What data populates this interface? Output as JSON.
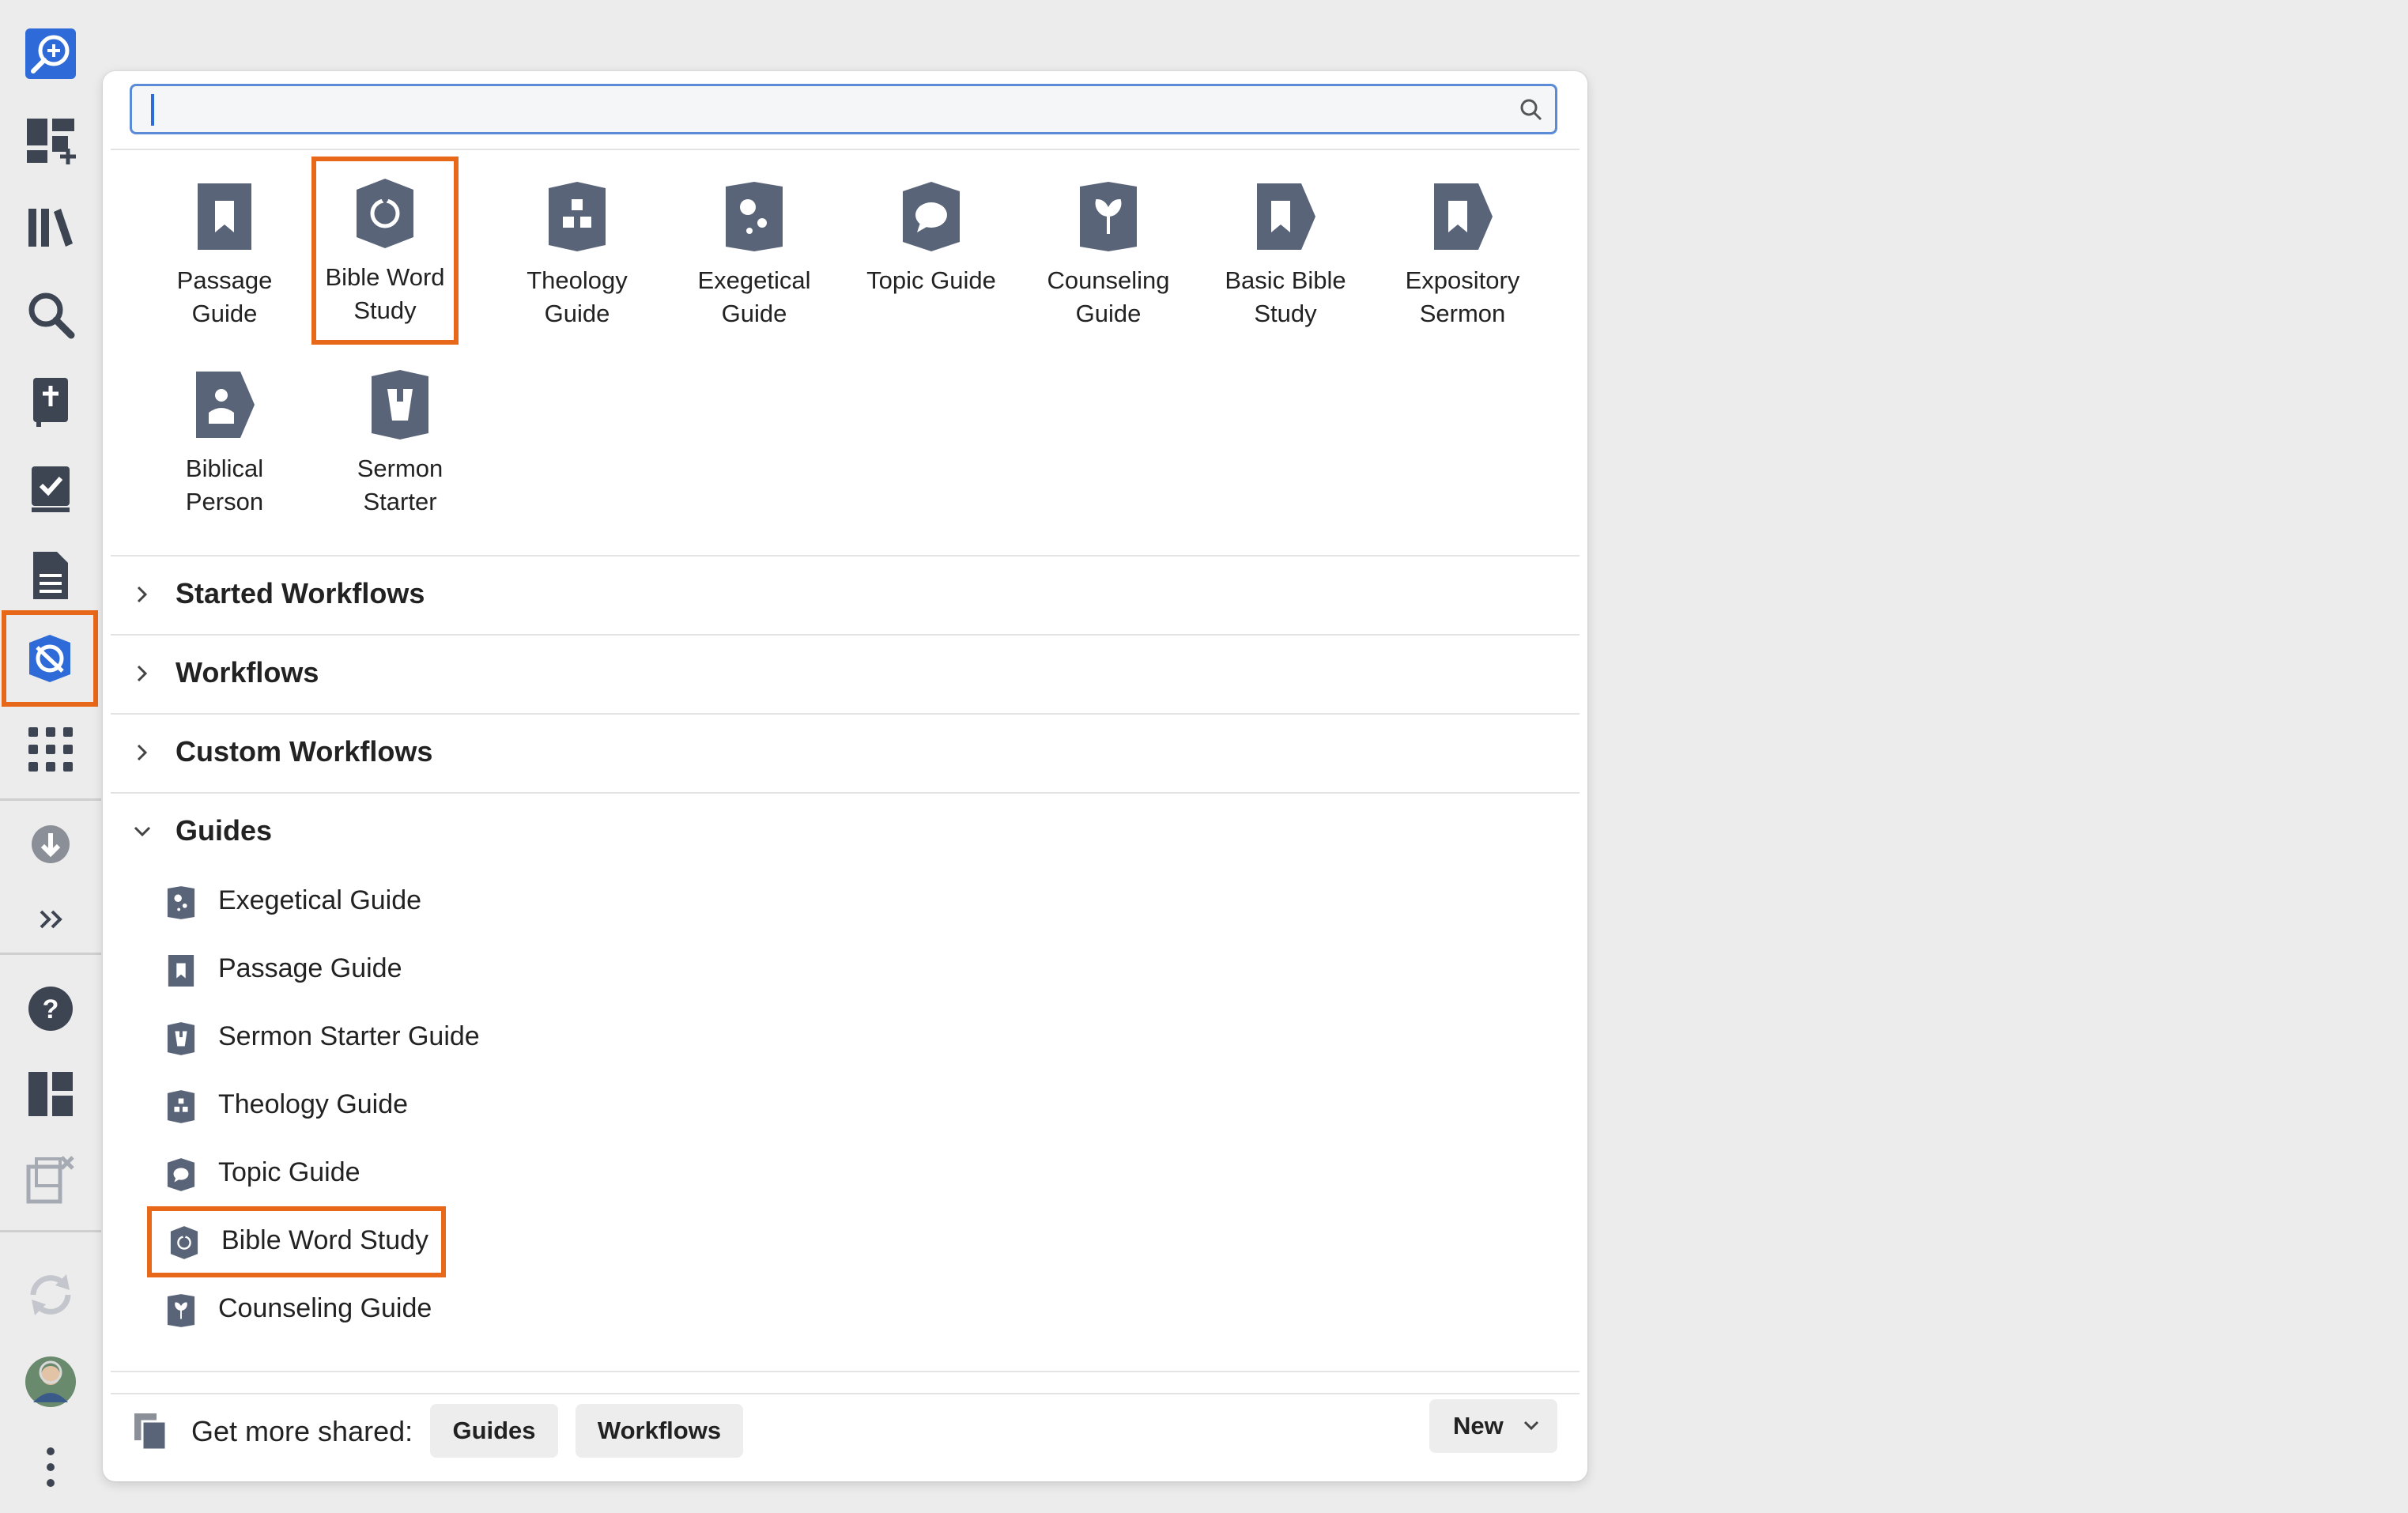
{
  "toolbar": {
    "items": [
      {
        "name": "search-home-icon",
        "color": "#2f6bd8"
      },
      {
        "name": "add-panel-icon"
      },
      {
        "name": "library-icon"
      },
      {
        "name": "search-icon"
      },
      {
        "name": "bible-icon"
      },
      {
        "name": "reading-plan-icon"
      },
      {
        "name": "document-icon"
      },
      {
        "name": "guides-icon",
        "selected": true
      },
      {
        "name": "apps-grid-icon"
      },
      {
        "name": "download-icon"
      },
      {
        "name": "more-chevrons-icon"
      },
      {
        "name": "help-icon"
      },
      {
        "name": "layouts-icon"
      },
      {
        "name": "close-panels-icon"
      },
      {
        "name": "sync-icon"
      },
      {
        "name": "avatar"
      },
      {
        "name": "kebab-menu-icon"
      }
    ]
  },
  "search": {
    "value": "",
    "placeholder": ""
  },
  "tiles": [
    {
      "label": "Passage\nGuide",
      "icon": "passage-guide-icon"
    },
    {
      "label": "Bible Word\nStudy",
      "icon": "bible-word-study-icon",
      "highlight": true
    },
    {
      "label": "Theology\nGuide",
      "icon": "theology-guide-icon"
    },
    {
      "label": "Exegetical\nGuide",
      "icon": "exegetical-guide-icon"
    },
    {
      "label": "Topic Guide",
      "icon": "topic-guide-icon"
    },
    {
      "label": "Counseling\nGuide",
      "icon": "counseling-guide-icon"
    },
    {
      "label": "Basic Bible\nStudy",
      "icon": "basic-bible-study-icon"
    },
    {
      "label": "Expository\nSermon",
      "icon": "expository-sermon-icon"
    },
    {
      "label": "Biblical\nPerson",
      "icon": "biblical-person-icon"
    },
    {
      "label": "Sermon\nStarter",
      "icon": "sermon-starter-icon"
    }
  ],
  "sections": {
    "started_workflows": "Started Workflows",
    "workflows": "Workflows",
    "custom_workflows": "Custom Workflows",
    "guides": "Guides"
  },
  "guides": [
    {
      "label": "Exegetical Guide",
      "icon": "exegetical-guide-icon"
    },
    {
      "label": "Passage Guide",
      "icon": "passage-guide-icon"
    },
    {
      "label": "Sermon Starter Guide",
      "icon": "sermon-starter-icon"
    },
    {
      "label": "Theology Guide",
      "icon": "theology-guide-icon"
    },
    {
      "label": "Topic Guide",
      "icon": "topic-guide-icon"
    },
    {
      "label": "Bible Word Study",
      "icon": "bible-word-study-icon",
      "highlight": true
    },
    {
      "label": "Counseling Guide",
      "icon": "counseling-guide-icon"
    }
  ],
  "footer": {
    "label": "Get more shared:",
    "guides_button": "Guides",
    "workflows_button": "Workflows",
    "new_button": "New"
  },
  "colors": {
    "highlight": "#e8681a",
    "icon_slate": "#5a6478",
    "accent_blue": "#2f6bd8"
  }
}
